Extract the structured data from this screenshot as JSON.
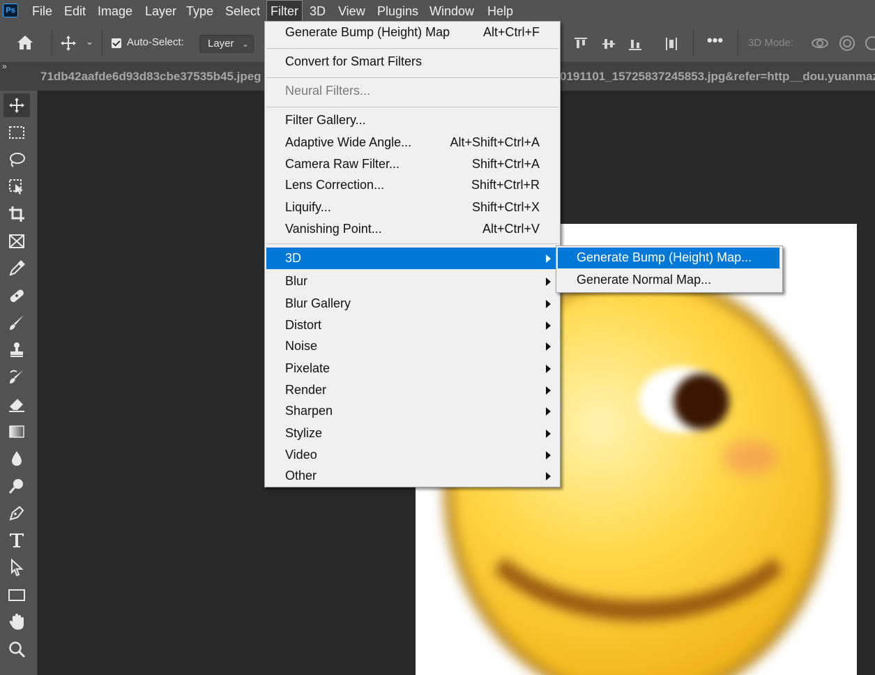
{
  "app": {
    "logo_text": "Ps"
  },
  "menubar": {
    "items": [
      "File",
      "Edit",
      "Image",
      "Layer",
      "Type",
      "Select",
      "Filter",
      "3D",
      "View",
      "Plugins",
      "Window",
      "Help"
    ],
    "active": "Filter"
  },
  "options_bar": {
    "auto_select_label": "Auto-Select:",
    "auto_select_checked": true,
    "layer_select_value": "Layer",
    "mode_3d_label": "3D Mode:"
  },
  "tabs": {
    "left": "71db42aafde6d93d83cbe37535b45.jpeg",
    "right": "0191101_15725837245853.jpg&refer=http__dou.yuanmaz"
  },
  "filter_menu": {
    "last_filter": {
      "label": "Generate Bump (Height) Map",
      "shortcut": "Alt+Ctrl+F"
    },
    "convert": {
      "label": "Convert for Smart Filters"
    },
    "neural": {
      "label": "Neural Filters..."
    },
    "filter_gallery": {
      "label": "Filter Gallery..."
    },
    "adaptive": {
      "label": "Adaptive Wide Angle...",
      "shortcut": "Alt+Shift+Ctrl+A"
    },
    "camera_raw": {
      "label": "Camera Raw Filter...",
      "shortcut": "Shift+Ctrl+A"
    },
    "lens": {
      "label": "Lens Correction...",
      "shortcut": "Shift+Ctrl+R"
    },
    "liquify": {
      "label": "Liquify...",
      "shortcut": "Shift+Ctrl+X"
    },
    "vanishing": {
      "label": "Vanishing Point...",
      "shortcut": "Alt+Ctrl+V"
    },
    "submenus": [
      "3D",
      "Blur",
      "Blur Gallery",
      "Distort",
      "Noise",
      "Pixelate",
      "Render",
      "Sharpen",
      "Stylize",
      "Video",
      "Other"
    ],
    "highlighted": "3D"
  },
  "submenu_3d": {
    "items": [
      "Generate Bump (Height) Map...",
      "Generate Normal Map..."
    ],
    "highlighted": "Generate Bump (Height) Map..."
  },
  "colors": {
    "highlight": "#0078d7",
    "menu_bg": "#f0f0f0",
    "chrome": "#535353",
    "workspace": "#282828"
  }
}
